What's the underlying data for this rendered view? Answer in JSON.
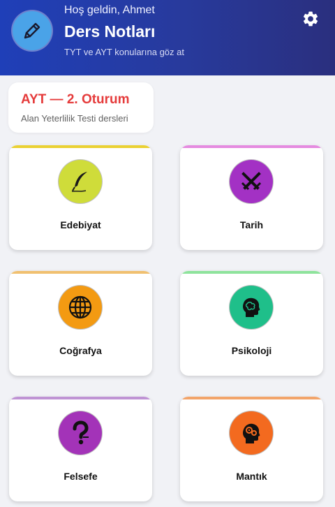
{
  "header": {
    "greeting": "Hoş geldin, Ahmet",
    "title": "Ders Notları",
    "subtitle": "TYT ve AYT konularına göz at",
    "app_icon": "pencil-icon",
    "settings_icon": "gear-icon"
  },
  "session": {
    "title": "AYT — 2. Oturum",
    "subtitle": "Alan Yeterlilik Testi dersleri",
    "title_color": "#e53b3b"
  },
  "subjects": [
    {
      "label": "Edebiyat",
      "icon": "quill-icon",
      "icon_bg": "#cfdc3a",
      "bar_color": "#ead132"
    },
    {
      "label": "Tarih",
      "icon": "crossed-swords-icon",
      "icon_bg": "#a331c4",
      "bar_color": "#e58be0"
    },
    {
      "label": "Coğrafya",
      "icon": "globe-icon",
      "icon_bg": "#f39a12",
      "bar_color": "#f0c070"
    },
    {
      "label": "Psikoloji",
      "icon": "head-icon",
      "icon_bg": "#1fbf8a",
      "bar_color": "#8ee39c"
    },
    {
      "label": "Felsefe",
      "icon": "question-mark-icon",
      "icon_bg": "#a333b8",
      "bar_color": "#bf93d4"
    },
    {
      "label": "Mantık",
      "icon": "brain-gears-icon",
      "icon_bg": "#f36a1f",
      "bar_color": "#f2a46a"
    }
  ]
}
